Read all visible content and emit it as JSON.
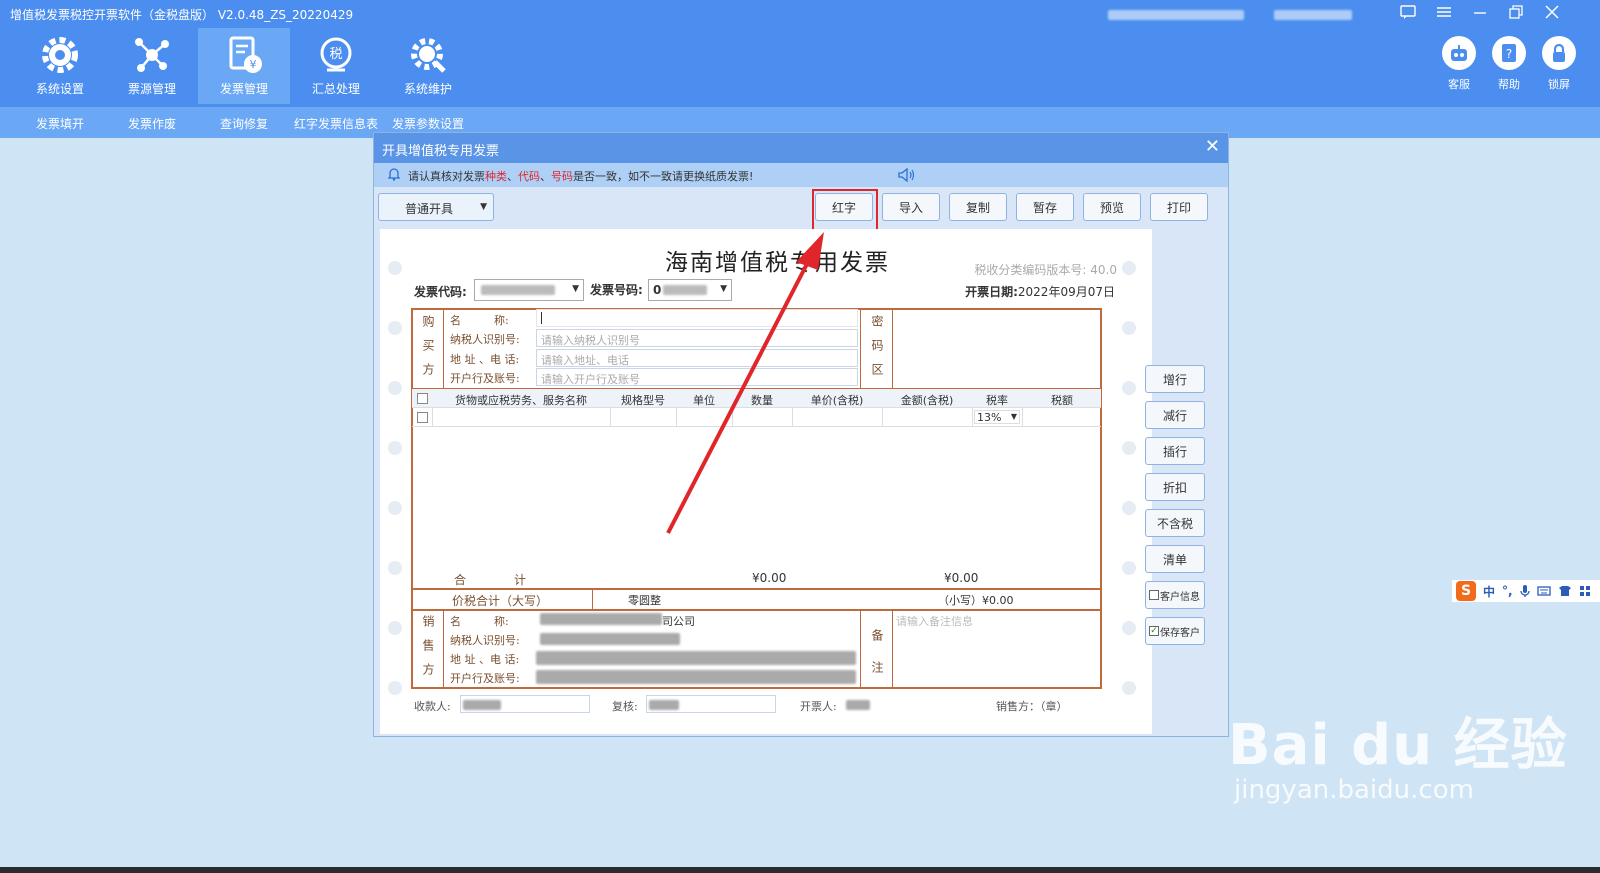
{
  "app": {
    "title": "增值税发票税控开票软件（金税盘版）  V2.0.48_ZS_20220429",
    "window_controls": [
      "message-icon",
      "menu-icon",
      "minimize-icon",
      "restore-icon",
      "close-icon"
    ]
  },
  "toolbar": {
    "items": [
      {
        "label": "系统设置",
        "icon": "gear-icon",
        "active": false
      },
      {
        "label": "票源管理",
        "icon": "network-icon",
        "active": false
      },
      {
        "label": "发票管理",
        "icon": "invoice-icon",
        "active": true
      },
      {
        "label": "汇总处理",
        "icon": "tax-summary-icon",
        "active": false
      },
      {
        "label": "系统维护",
        "icon": "maintenance-icon",
        "active": false
      }
    ],
    "right_items": [
      {
        "label": "客服",
        "icon": "robot-icon"
      },
      {
        "label": "帮助",
        "icon": "help-icon"
      },
      {
        "label": "锁屏",
        "icon": "lock-icon"
      }
    ]
  },
  "subnav": [
    "发票填开",
    "发票作废",
    "查询修复",
    "红字发票信息表",
    "发票参数设置"
  ],
  "dialog": {
    "title": "开具增值税专用发票",
    "notice_prefix": "请认真核对发票",
    "notice_kind": "种类",
    "notice_sep1": "、",
    "notice_code": "代码",
    "notice_sep2": "、",
    "notice_number": "号码",
    "notice_suffix": "是否一致，如不一致请更换纸质发票!",
    "mode": "普通开具",
    "buttons": [
      "红字",
      "导入",
      "复制",
      "暂存",
      "预览",
      "打印"
    ],
    "highlighted_button": "红字",
    "side_buttons": [
      "增行",
      "减行",
      "插行",
      "折扣",
      "不含税",
      "清单"
    ],
    "side_checks": [
      {
        "label": "客户信息",
        "checked": false
      },
      {
        "label": "保存客户",
        "checked": true
      }
    ]
  },
  "invoice": {
    "title": "海南增值税专用发票",
    "tax_version": "税收分类编码版本号: 40.0",
    "code_label": "发票代码:",
    "number_label": "发票号码:",
    "number_value": "0",
    "date_label": "开票日期:",
    "date_value": "2022年09月07日",
    "buyer_side": "购买方",
    "buyer_fields": [
      {
        "label": "名　　　称:",
        "placeholder": ""
      },
      {
        "label": "纳税人识别号:",
        "placeholder": "请输入纳税人识别号"
      },
      {
        "label": "地 址 、电 话:",
        "placeholder": "请输入地址、电话"
      },
      {
        "label": "开户行及账号:",
        "placeholder": "请输入开户行及账号"
      }
    ],
    "cipher_label": "密码区",
    "columns": [
      "货物或应税劳务、服务名称",
      "规格型号",
      "单位",
      "数量",
      "单价(含税)",
      "金额(含税)",
      "税率",
      "税额"
    ],
    "rate_value": "13%",
    "total_label": "合　　　　计",
    "total_amount": "¥0.00",
    "total_tax": "¥0.00",
    "price_tax_label": "价税合计（大写）",
    "price_tax_upper": "零圆整",
    "price_tax_lower_label": "（小写）",
    "price_tax_lower": "¥0.00",
    "seller_side": "销售方",
    "seller_fields": [
      "名　　　称:",
      "纳税人识别号:",
      "地 址 、电 话:",
      "开户行及账号:"
    ],
    "seller_name_suffix": "司公司",
    "remark_label": "备注",
    "remark_placeholder": "请输入备注信息",
    "payee_label": "收款人:",
    "reviewer_label": "复核:",
    "drawer_label": "开票人:",
    "seller_seal_label": "销售方：（章）"
  },
  "ime": {
    "logo": "S",
    "items": [
      "中",
      "°,"
    ]
  },
  "watermark": {
    "main": "Bai du 经验",
    "sub": "jingyan.baidu.com"
  },
  "colors": {
    "primary": "#4b8ef0",
    "accent_red": "#e0262a",
    "invoice_border": "#c0693c"
  }
}
